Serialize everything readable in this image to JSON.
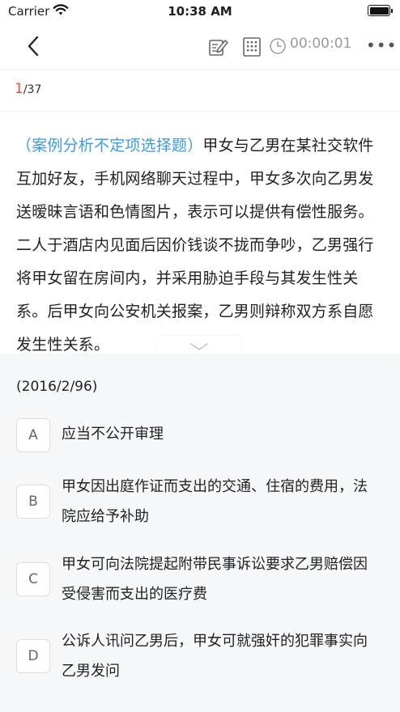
{
  "status": {
    "carrier": "Carrier",
    "time": "10:38 AM"
  },
  "nav": {
    "timer": "00:00:01",
    "more": "•••"
  },
  "progress": {
    "current": "1",
    "total": "/37"
  },
  "question": {
    "type_label": "（案例分析不定项选择题）",
    "text": "甲女与乙男在某社交软件互加好友，手机网络聊天过程中，甲女多次向乙男发送暧昧言语和色情图片，表示可以提供有偿性服务。二人于酒店内见面后因价钱谈不拢而争吵，乙男强行将甲女留在房间内，并采用胁迫手段与其发生性关系。后甲女向公安机关报案，乙男则辩称双方系自愿发生性关系。"
  },
  "source": "(2016/2/96)",
  "options": [
    {
      "letter": "A",
      "text": "应当不公开审理"
    },
    {
      "letter": "B",
      "text": "甲女因出庭作证而支出的交通、住宿的费用，法院应给予补助"
    },
    {
      "letter": "C",
      "text": "甲女可向法院提起附带民事诉讼要求乙男赔偿因受侵害而支出的医疗费"
    },
    {
      "letter": "D",
      "text": "公诉人讯问乙男后，甲女可就强奸的犯罪事实向乙男发问"
    }
  ],
  "colors": {
    "accent_blue": "#3b9be8",
    "progress_red": "#e0533a",
    "panel_bg": "#f6f7f9"
  },
  "icons": [
    "wifi-icon",
    "battery-icon",
    "back-arrow-icon",
    "note-edit-icon",
    "answer-sheet-icon",
    "clock-icon",
    "more-icon",
    "chevron-down-icon"
  ]
}
